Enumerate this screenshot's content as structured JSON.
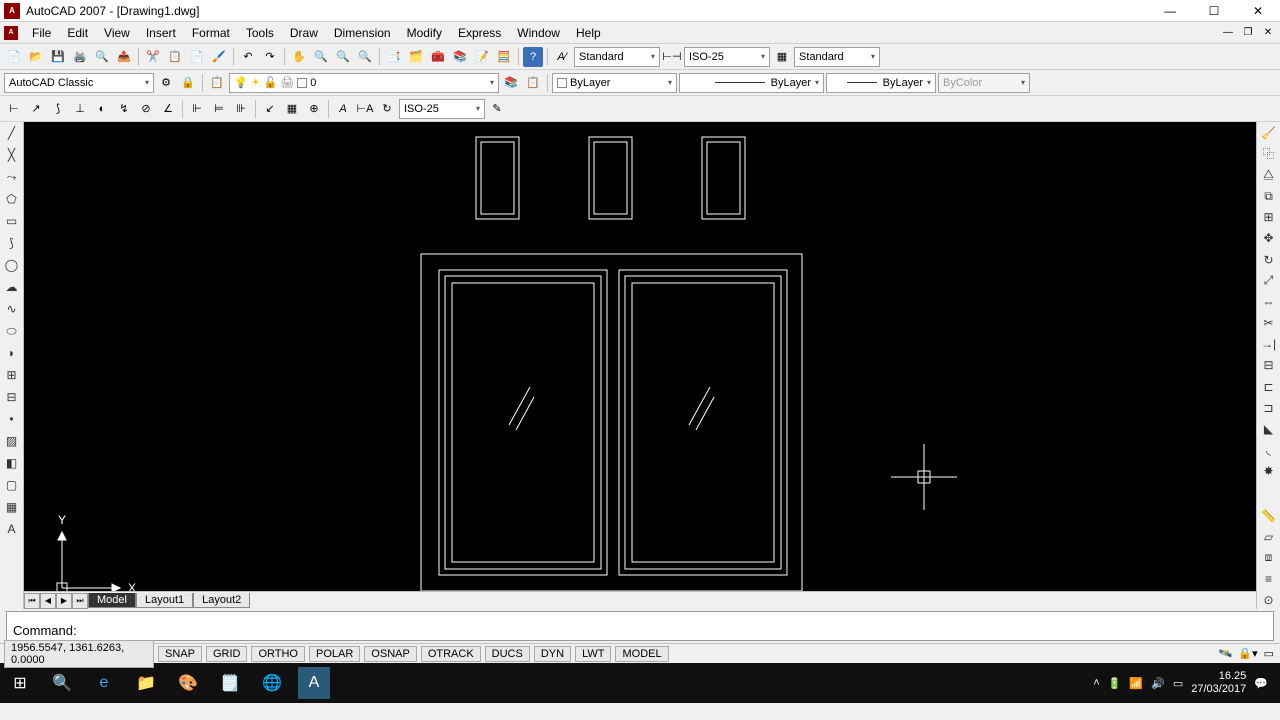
{
  "title": "AutoCAD 2007 - [Drawing1.dwg]",
  "menus": [
    "File",
    "Edit",
    "View",
    "Insert",
    "Format",
    "Tools",
    "Draw",
    "Dimension",
    "Modify",
    "Express",
    "Window",
    "Help"
  ],
  "workspace_combo": "AutoCAD Classic",
  "style_combo1": "Standard",
  "style_combo2": "ISO-25",
  "style_combo3": "Standard",
  "layer_combo": "0",
  "bylayer1": "ByLayer",
  "bylayer2": "ByLayer",
  "bylayer3": "ByLayer",
  "bycolor": "ByColor",
  "dim_style": "ISO-25",
  "tabs": {
    "model": "Model",
    "layout1": "Layout1",
    "layout2": "Layout2"
  },
  "command_prompt": "Command:",
  "coords": "1956.5547, 1361.6263, 0.0000",
  "status_toggles": [
    "SNAP",
    "GRID",
    "ORTHO",
    "POLAR",
    "OSNAP",
    "OTRACK",
    "DUCS",
    "DYN",
    "LWT",
    "MODEL"
  ],
  "ucs": {
    "x": "X",
    "y": "Y"
  },
  "clock": {
    "time": "16.25",
    "date": "27/03/2017"
  }
}
